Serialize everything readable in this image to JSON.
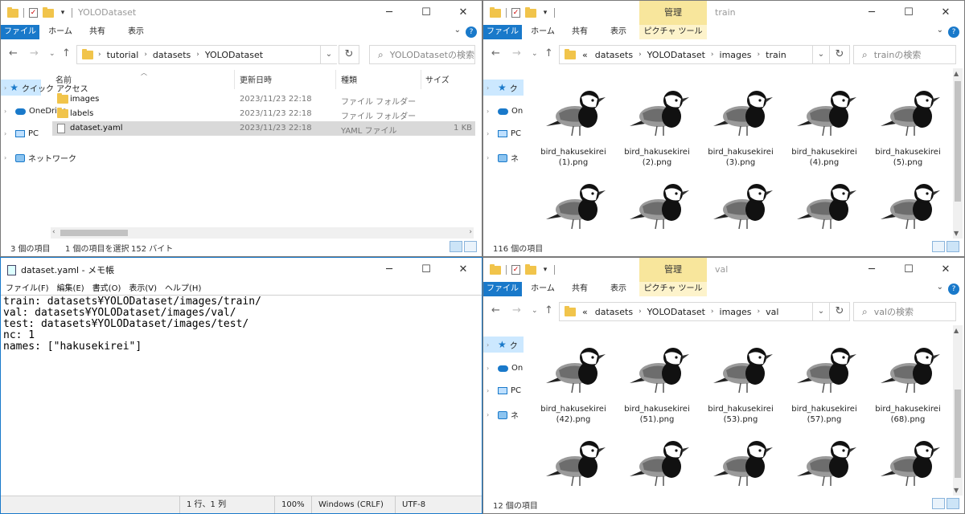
{
  "icons": {
    "search": "search-icon",
    "folder": "folder-icon",
    "refresh": "refresh-icon"
  },
  "explorer_main": {
    "title": "YOLODataset",
    "tabs": [
      "ファイル",
      "ホーム",
      "共有",
      "表示"
    ],
    "breadcrumb": [
      "tutorial",
      "datasets",
      "YOLODataset"
    ],
    "search_placeholder": "YOLODatasetの検索",
    "columns": {
      "name": "名前",
      "date": "更新日時",
      "type": "種類",
      "size": "サイズ"
    },
    "files": [
      {
        "name": "images",
        "date": "2023/11/23 22:18",
        "type": "ファイル フォルダー",
        "size": "",
        "kind": "folder"
      },
      {
        "name": "labels",
        "date": "2023/11/23 22:18",
        "type": "ファイル フォルダー",
        "size": "",
        "kind": "folder"
      },
      {
        "name": "dataset.yaml",
        "date": "2023/11/23 22:18",
        "type": "YAML ファイル",
        "size": "1 KB",
        "kind": "file"
      }
    ],
    "status": {
      "count": "3 個の項目",
      "selected": "1 個の項目を選択",
      "bytes": "152 バイト"
    },
    "nav_items": [
      "クイック アクセス",
      "OneDrive",
      "PC",
      "ネットワーク"
    ]
  },
  "explorer_train": {
    "manage_label": "管理",
    "title": "train",
    "tabs": [
      "ファイル",
      "ホーム",
      "共有",
      "表示",
      "ピクチャ ツール"
    ],
    "breadcrumb_prefix": "«",
    "breadcrumb": [
      "datasets",
      "YOLODataset",
      "images",
      "train"
    ],
    "search_placeholder": "trainの検索",
    "thumbs": [
      {
        "l1": "bird_hakusekirei",
        "l2": "(1).png"
      },
      {
        "l1": "bird_hakusekirei",
        "l2": "(2).png"
      },
      {
        "l1": "bird_hakusekirei",
        "l2": "(3).png"
      },
      {
        "l1": "bird_hakusekirei",
        "l2": "(4).png"
      },
      {
        "l1": "bird_hakusekirei",
        "l2": "(5).png"
      }
    ],
    "status_count": "116 個の項目",
    "nav_items": [
      "ク",
      "On",
      "PC",
      "ネ"
    ]
  },
  "explorer_val": {
    "manage_label": "管理",
    "title": "val",
    "tabs": [
      "ファイル",
      "ホーム",
      "共有",
      "表示",
      "ピクチャ ツール"
    ],
    "breadcrumb_prefix": "«",
    "breadcrumb": [
      "datasets",
      "YOLODataset",
      "images",
      "val"
    ],
    "search_placeholder": "valの検索",
    "thumbs": [
      {
        "l1": "bird_hakusekirei",
        "l2": "(42).png"
      },
      {
        "l1": "bird_hakusekirei",
        "l2": "(51).png"
      },
      {
        "l1": "bird_hakusekirei",
        "l2": "(53).png"
      },
      {
        "l1": "bird_hakusekirei",
        "l2": "(57).png"
      },
      {
        "l1": "bird_hakusekirei",
        "l2": "(68).png"
      }
    ],
    "status_count": "12 個の項目",
    "nav_items": [
      "ク",
      "On",
      "PC",
      "ネ"
    ]
  },
  "notepad": {
    "title": "dataset.yaml - メモ帳",
    "menu": [
      "ファイル(F)",
      "編集(E)",
      "書式(O)",
      "表示(V)",
      "ヘルプ(H)"
    ],
    "lines": [
      "train: datasets¥YOLODataset/images/train/",
      "val: datasets¥YOLODataset/images/val/",
      "test: datasets¥YOLODataset/images/test/",
      "nc: 1",
      "names: [\"hakusekirei\"]"
    ],
    "status": {
      "position": "1 行、1 列",
      "zoom": "100%",
      "eol": "Windows (CRLF)",
      "encoding": "UTF-8"
    }
  }
}
